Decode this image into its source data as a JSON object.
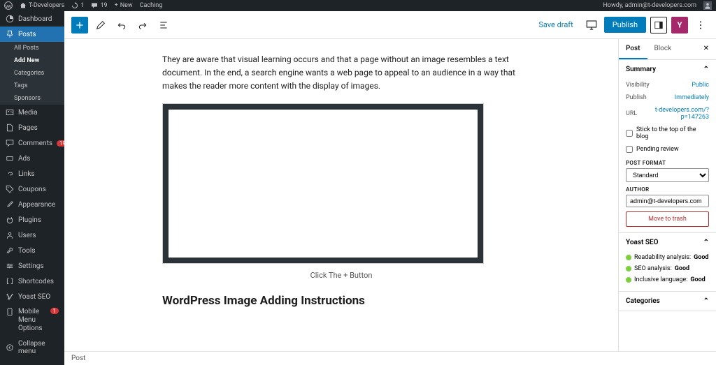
{
  "adminbar": {
    "site": "T-Developers",
    "updates": "1",
    "comments": "19",
    "new": "New",
    "caching": "Caching",
    "howdy": "Howdy, admin@t-developers.com"
  },
  "sidebar": {
    "dashboard": "Dashboard",
    "posts": "Posts",
    "all_posts": "All Posts",
    "add_new": "Add New",
    "categories": "Categories",
    "tags": "Tags",
    "sponsors": "Sponsors",
    "media": "Media",
    "pages": "Pages",
    "comments": "Comments",
    "comments_badge": "19",
    "ads": "Ads",
    "links": "Links",
    "coupons": "Coupons",
    "appearance": "Appearance",
    "plugins": "Plugins",
    "users": "Users",
    "tools": "Tools",
    "settings": "Settings",
    "shortcodes": "Shortcodes",
    "yoast": "Yoast SEO",
    "mobile_menu": "Mobile Menu Options",
    "mobile_badge": "1",
    "collapse": "Collapse menu"
  },
  "toolbar": {
    "save_draft": "Save draft",
    "publish": "Publish"
  },
  "content": {
    "para1": "They are aware that visual learning occurs and that a page without an image resembles a text document. In the end, a search engine wants a web page to appeal to an audience in a way that makes the reader more content with the display of images.",
    "caption": "Click The + Button",
    "heading": "WordPress Image Adding Instructions"
  },
  "settings": {
    "tab_post": "Post",
    "tab_block": "Block",
    "summary": "Summary",
    "visibility_label": "Visibility",
    "visibility_value": "Public",
    "publish_label": "Publish",
    "publish_value": "Immediately",
    "url_label": "URL",
    "url_value": "t-developers.com/?p=147263",
    "stick": "Stick to the top of the blog",
    "pending": "Pending review",
    "post_format": "POST FORMAT",
    "post_format_value": "Standard",
    "author": "AUTHOR",
    "author_value": "admin@t-developers.com",
    "trash": "Move to trash",
    "yoast_head": "Yoast SEO",
    "readability": "Readability analysis:",
    "seo": "SEO analysis:",
    "inclusive": "Inclusive language:",
    "good": "Good",
    "categories_head": "Categories"
  },
  "breadcrumb": "Post"
}
